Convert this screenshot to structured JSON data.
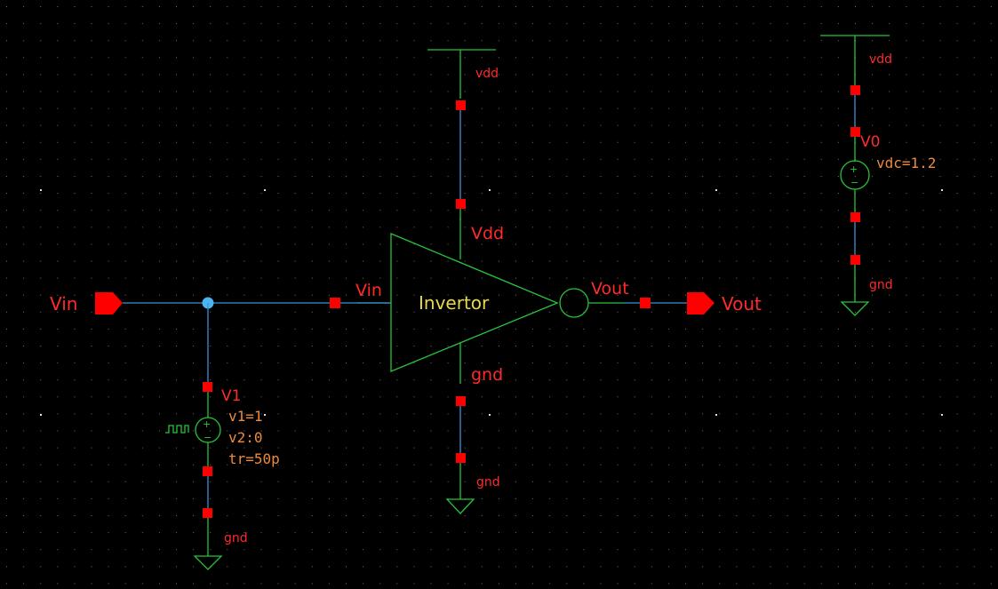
{
  "colors": {
    "background": "#000000",
    "wire": "#3b8fd6",
    "symbol": "#27c43a",
    "pin": "#ff0000",
    "label_red": "#ff2a2a",
    "param_orange": "#ee8a3c",
    "cell_yellow": "#e8d84a",
    "junction": "#4cb4f0"
  },
  "inverter": {
    "cell_name": "Invertor",
    "pin_in": "Vin",
    "pin_out": "Vout",
    "pin_vdd": "Vdd",
    "pin_gnd": "gnd",
    "supply_net": "vdd",
    "ground_net": "gnd"
  },
  "ports": {
    "input": "Vin",
    "output": "Vout"
  },
  "pulse_source": {
    "instance": "V1",
    "params": [
      "v1=1",
      "v2:0",
      "tr=50p"
    ],
    "ground_net": "gnd"
  },
  "dc_source": {
    "instance": "V0",
    "param": "vdc=1.2",
    "supply_net": "vdd",
    "ground_net": "gnd"
  }
}
